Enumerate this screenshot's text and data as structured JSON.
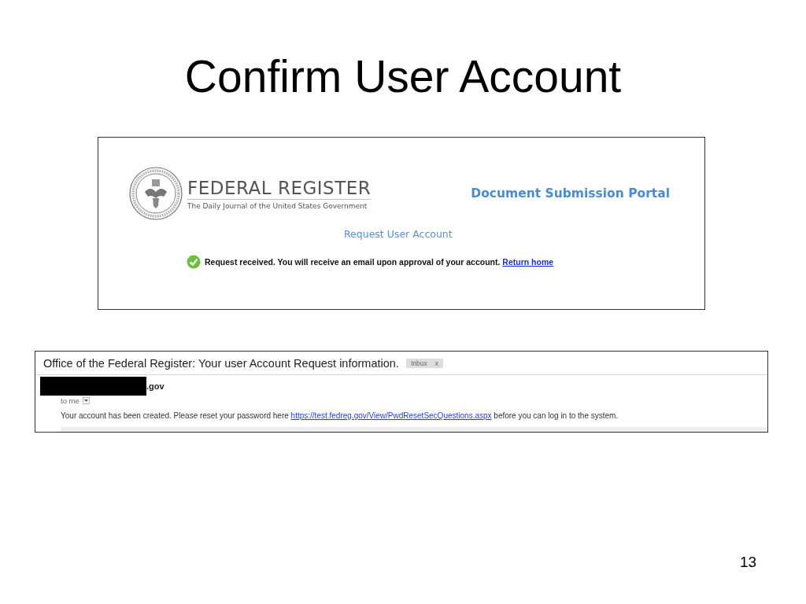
{
  "slide": {
    "title": "Confirm User Account",
    "page_number": "13"
  },
  "portal": {
    "logo_title": "FEDERAL REGISTER",
    "logo_subtitle": "The Daily Journal of the United States Government",
    "portal_title": "Document Submission Portal",
    "page_heading": "Request User Account",
    "message": "Request received. You will receive an email upon approval of your account.",
    "link": "Return home"
  },
  "email": {
    "subject": "Office of the Federal Register: Your user Account Request information.",
    "label": {
      "text": "Inbox",
      "close": "x"
    },
    "sender": ".gov",
    "recipient": "to me",
    "body_before": "Your account has been created. Please reset your password here",
    "link": "https://test.fedreg.gov/View/PwdResetSecQuestions.aspx",
    "body_after": "before you can log in to the system."
  }
}
